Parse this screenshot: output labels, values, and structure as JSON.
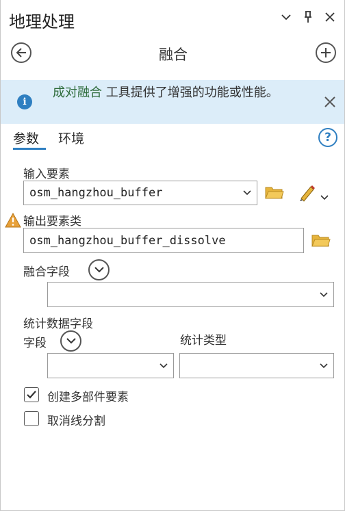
{
  "pane": {
    "title": "地理处理",
    "tool_title": "融合"
  },
  "banner": {
    "link_text": "成对融合",
    "text": " 工具提供了增强的功能或性能。"
  },
  "tabs": [
    {
      "label": "参数",
      "active": true
    },
    {
      "label": "环境",
      "active": false
    }
  ],
  "params": {
    "input_label": "输入要素",
    "input_value": "osm_hangzhou_buffer",
    "output_label": "输出要素类",
    "output_value": "osm_hangzhou_buffer_dissolve",
    "dissolve_label": "融合字段",
    "dissolve_value": "",
    "stats_label": "统计数据字段",
    "field_label": "字段",
    "stat_type_label": "统计类型",
    "field_value": "",
    "stat_type_value": "",
    "multipart_label": "创建多部件要素",
    "multipart_checked": true,
    "unsplit_label": "取消线分割",
    "unsplit_checked": false
  },
  "colors": {
    "accent": "#2f7fc1",
    "banner_bg": "#dcedf9",
    "warning": "#e8a13a",
    "folder": "#e6b43c"
  }
}
